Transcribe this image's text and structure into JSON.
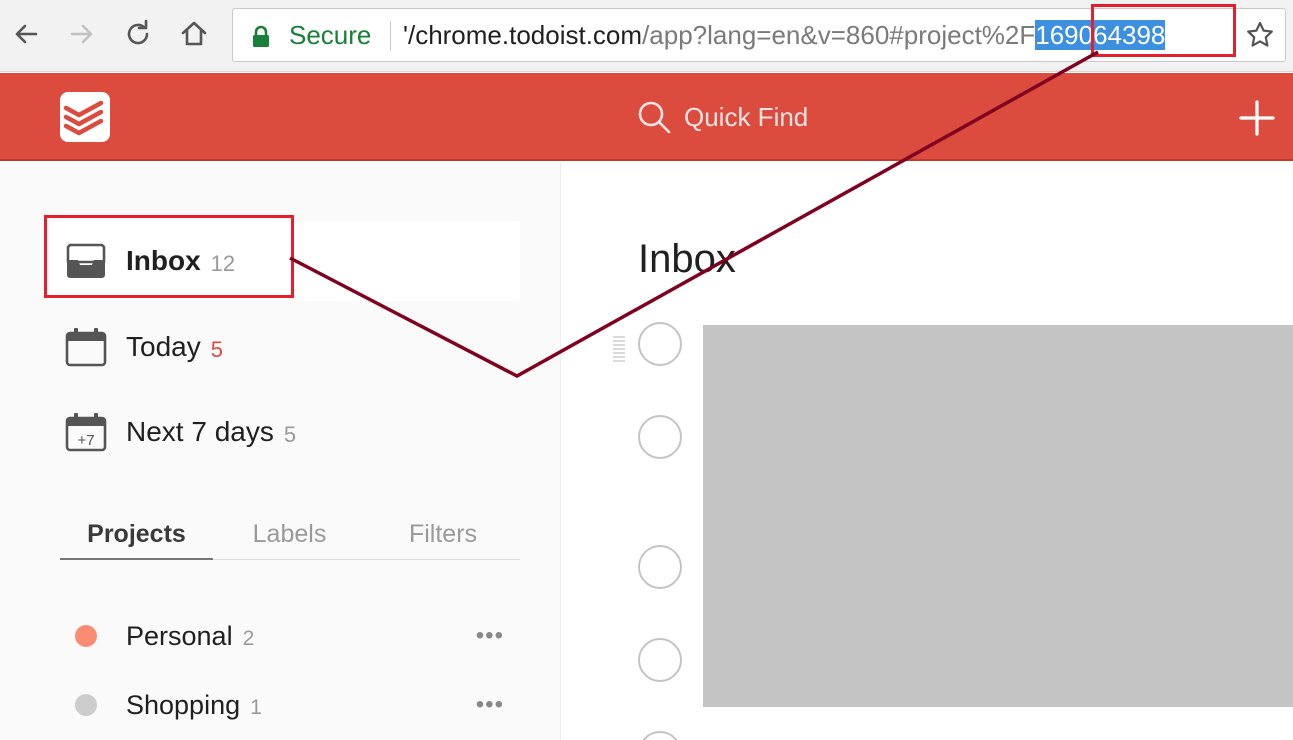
{
  "browser": {
    "secure_label": "Secure",
    "url_prefix": "'/chrome.todoist.com",
    "url_path": "/app?lang=en&v=860#project%2F",
    "url_selected": "169064398"
  },
  "header": {
    "quick_find_label": "Quick Find",
    "brand_color": "#db4c3f"
  },
  "sidebar": {
    "filters": [
      {
        "label": "Inbox",
        "count": "12",
        "icon": "inbox-icon"
      },
      {
        "label": "Today",
        "count": "5",
        "icon": "calendar-icon"
      },
      {
        "label": "Next 7 days",
        "count": "5",
        "icon": "calendar-plus7-icon",
        "icon_text": "+7"
      }
    ],
    "tabs": [
      "Projects",
      "Labels",
      "Filters"
    ],
    "projects": [
      {
        "label": "Personal",
        "count": "2",
        "color": "#f98d74"
      },
      {
        "label": "Shopping",
        "count": "1",
        "color": "#cccccc"
      }
    ],
    "more_label": "•••"
  },
  "main": {
    "title": "Inbox"
  },
  "annotation": {
    "highlight_color": "#e3202c",
    "connector_color": "#800020"
  }
}
